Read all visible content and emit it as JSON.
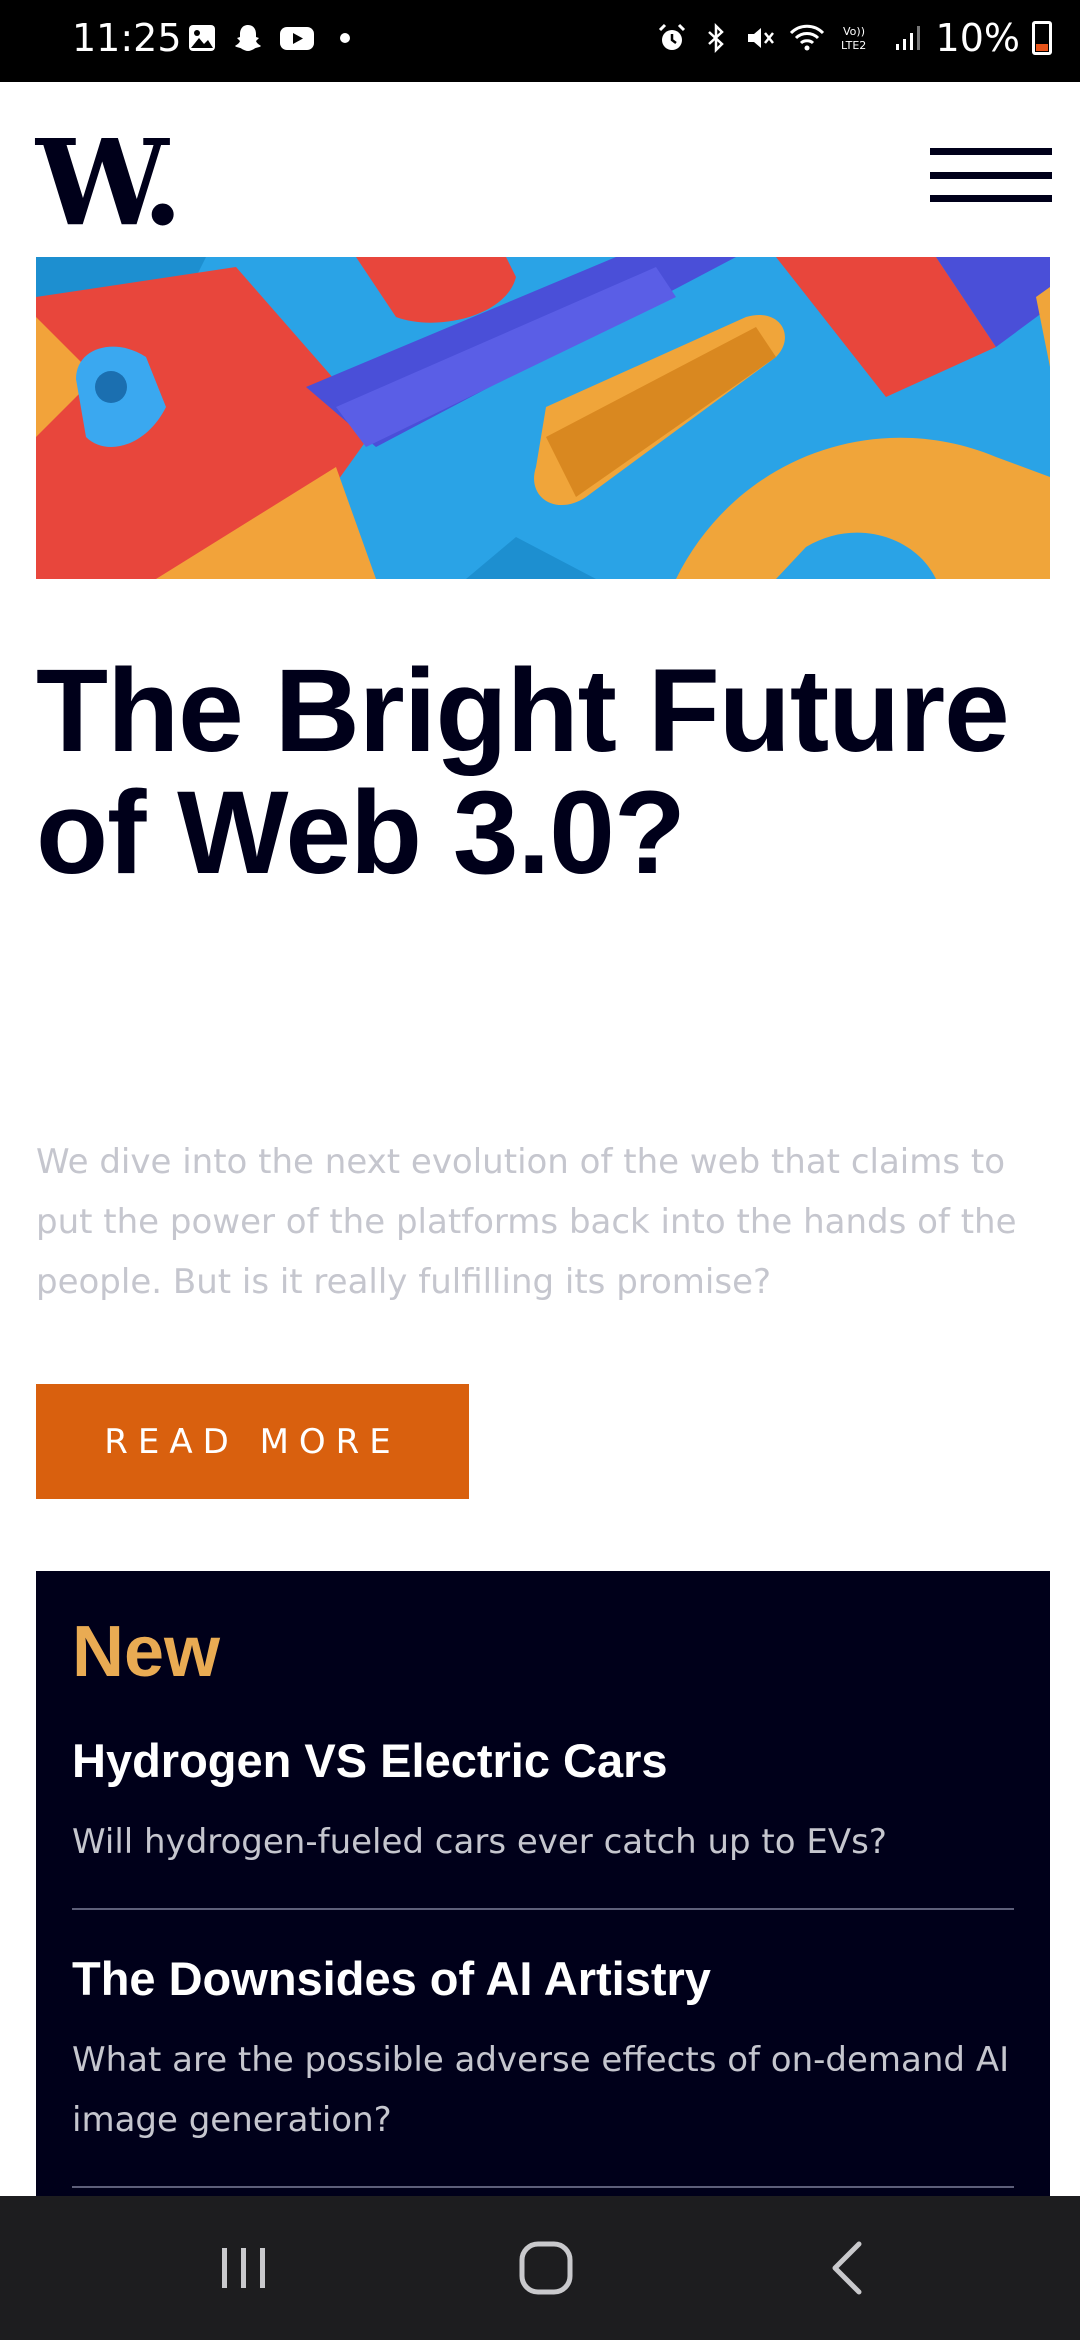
{
  "status_bar": {
    "time": "11:25",
    "battery": "10%",
    "icons": [
      "gallery-icon",
      "snapchat-icon",
      "youtube-icon",
      "notification-dot",
      "alarm-icon",
      "bluetooth-icon",
      "mute-icon",
      "wifi-icon",
      "volte-icon",
      "signal-icon",
      "battery-icon"
    ]
  },
  "header": {
    "logo": "W.",
    "menu_icon": "hamburger-icon"
  },
  "article": {
    "title": "The Bright Future of Web 3.0?",
    "summary": "We dive into the next evolution of the web that claims to put the power of the platforms back into the hands of the people. But is it really fulfilling its promise?",
    "cta": "READ MORE"
  },
  "new_section": {
    "heading": "New",
    "items": [
      {
        "title": "Hydrogen VS Electric Cars",
        "description": "Will hydrogen-fueled cars ever catch up to EVs?"
      },
      {
        "title": "The Downsides of AI Artistry",
        "description": "What are the possible adverse effects of on-demand AI image generation?"
      }
    ]
  },
  "colors": {
    "accent": "#d9600e",
    "dark": "#00001a",
    "gold": "#e9ab53",
    "muted_text": "#c5c6ce"
  },
  "nav_bar": {
    "buttons": [
      "recent-apps-icon",
      "home-icon",
      "back-icon"
    ]
  }
}
